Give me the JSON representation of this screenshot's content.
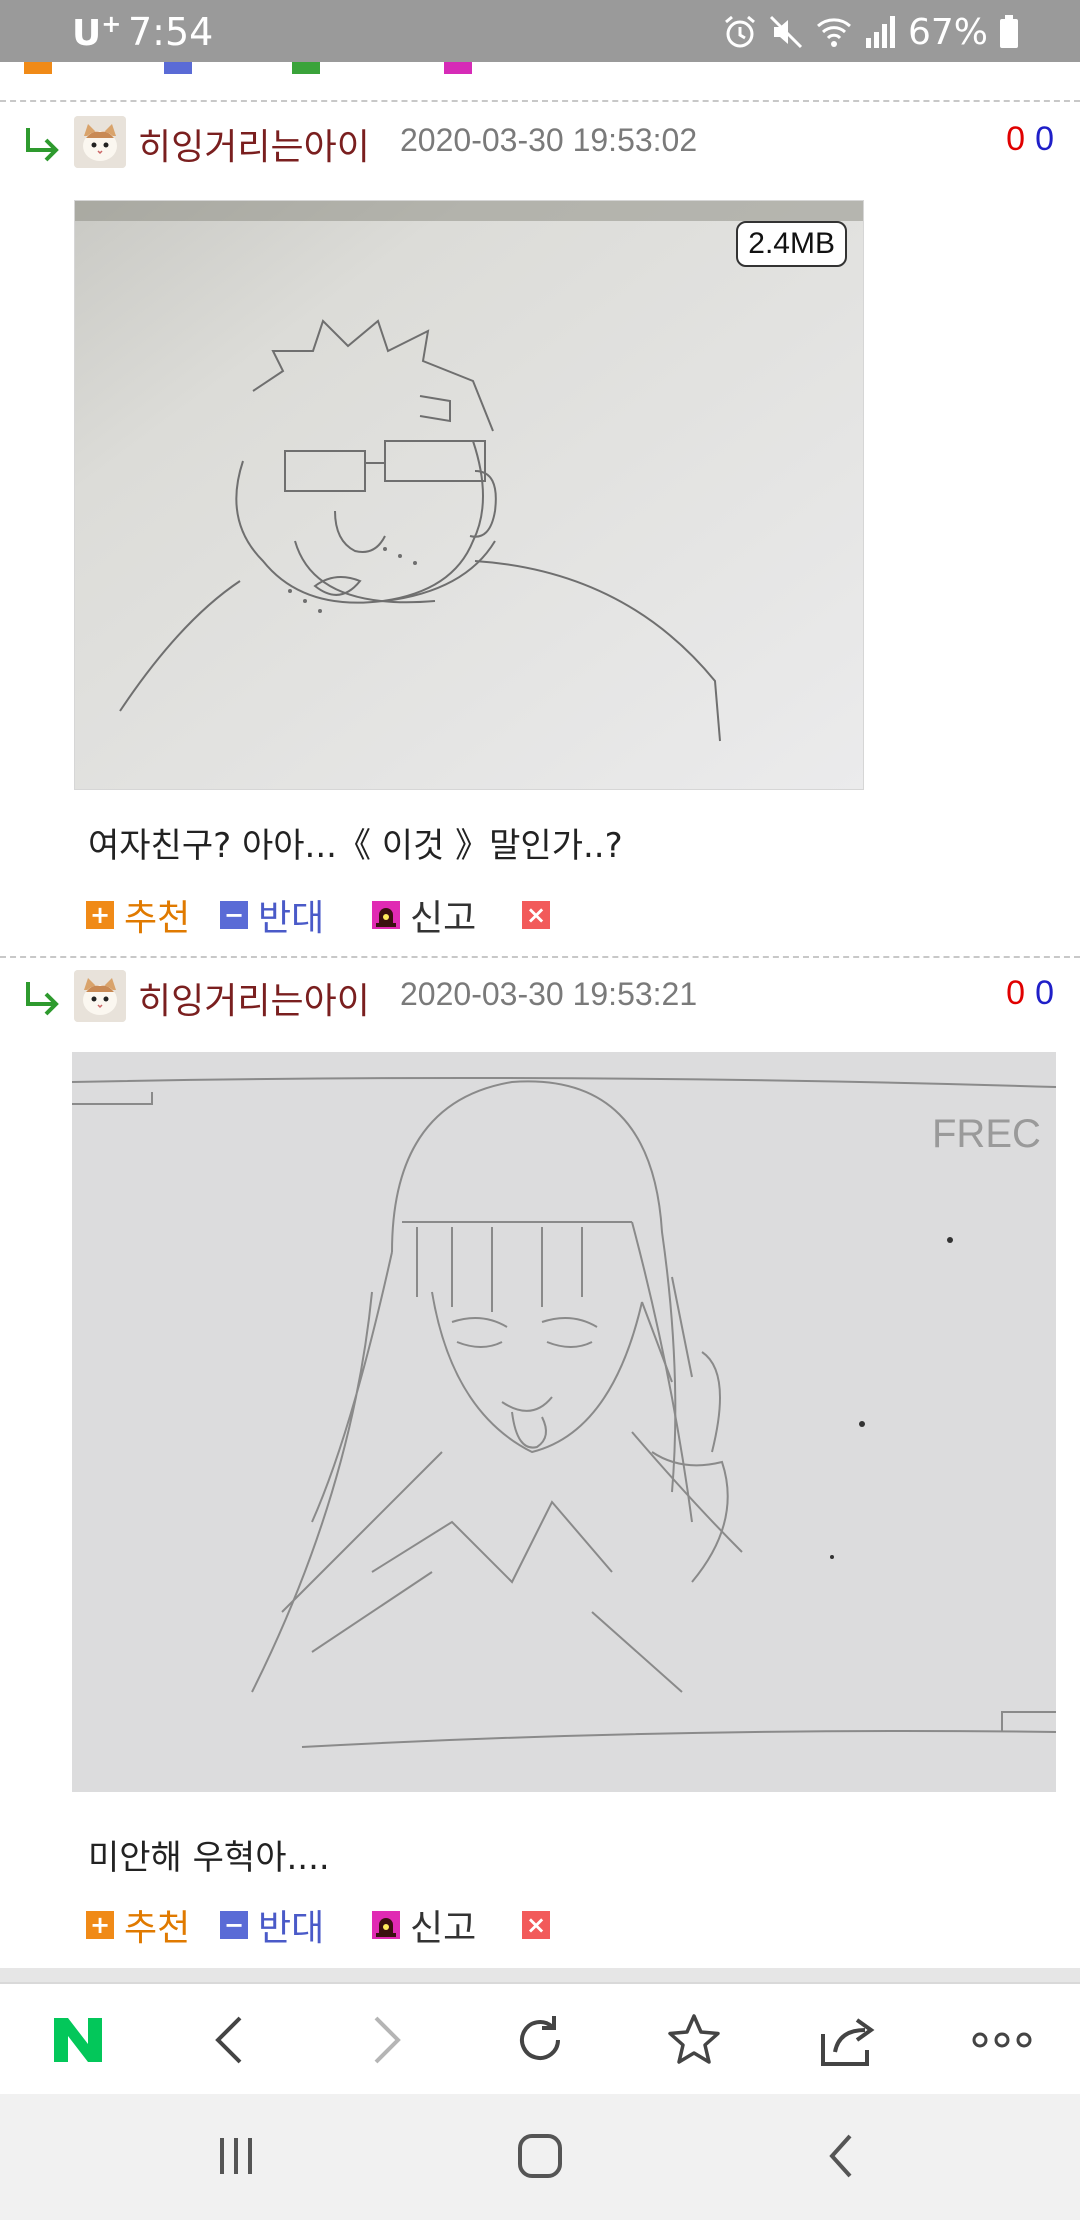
{
  "status_bar": {
    "carrier": "U",
    "carrier_sup": "+",
    "time": "7:54",
    "battery": "67%",
    "icons": [
      "alarm-icon",
      "mute-icon",
      "wifi-icon",
      "signal-icon",
      "battery-icon"
    ]
  },
  "actions_labels": {
    "recommend": "추천",
    "oppose": "반대",
    "report": "신고",
    "delete": "×"
  },
  "comments": [
    {
      "author": "히잉거리는아이",
      "date": "2020-03-30 19:53:02",
      "votes_up": "0",
      "votes_down": "0",
      "image_size": "2.4MB",
      "text": "여자친구? 아아...《 이것 》말인가..?"
    },
    {
      "author": "히잉거리는아이",
      "date": "2020-03-30 19:53:21",
      "votes_up": "0",
      "votes_down": "0",
      "text": "미안해 우혁아...."
    }
  ],
  "sketch_text": "FREC",
  "toolbar": {
    "icons": [
      "naver-n-icon",
      "back-icon",
      "forward-icon",
      "refresh-icon",
      "bookmark-star-icon",
      "share-icon",
      "more-icon"
    ],
    "brand_color": "#03c75a"
  },
  "nav_bar": {
    "icons": [
      "recent-apps-icon",
      "home-icon",
      "nav-back-icon"
    ]
  }
}
